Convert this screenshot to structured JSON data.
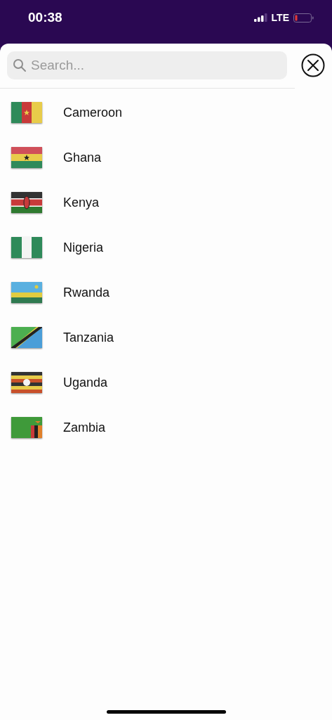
{
  "status_bar": {
    "time": "00:38",
    "network": "LTE"
  },
  "search": {
    "placeholder": "Search..."
  },
  "countries": [
    {
      "name": "Cameroon",
      "kind": "cm"
    },
    {
      "name": "Ghana",
      "kind": "gh"
    },
    {
      "name": "Kenya",
      "kind": "ke"
    },
    {
      "name": "Nigeria",
      "kind": "ng"
    },
    {
      "name": "Rwanda",
      "kind": "rw"
    },
    {
      "name": "Tanzania",
      "kind": "tz"
    },
    {
      "name": "Uganda",
      "kind": "ug"
    },
    {
      "name": "Zambia",
      "kind": "zm"
    }
  ]
}
